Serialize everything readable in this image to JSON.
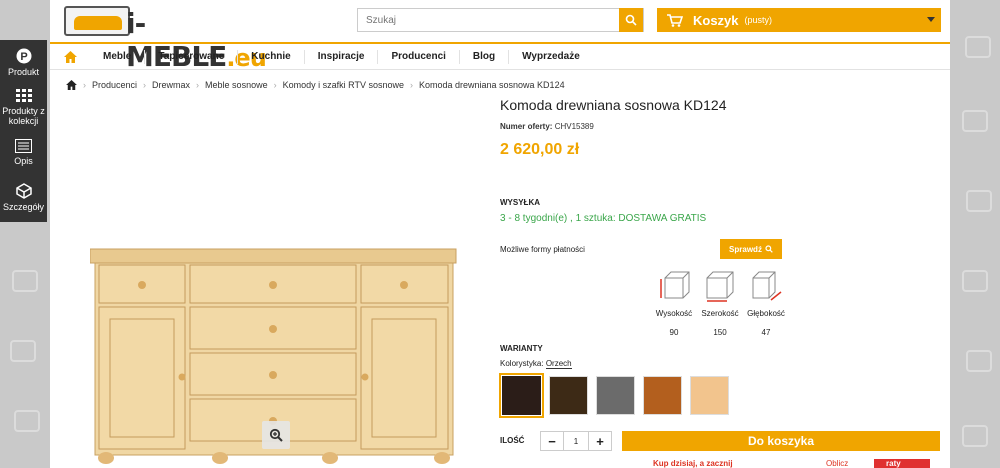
{
  "header": {
    "logo_text": "i-MEBLE",
    "logo_suffix": ".eu",
    "search_placeholder": "Szukaj",
    "cart_label": "Koszyk",
    "cart_status": "(pusty)"
  },
  "nav": {
    "items": [
      "Meble",
      "Tapicerowane",
      "Kuchnie",
      "Inspiracje",
      "Producenci",
      "Blog",
      "Wyprzedaże"
    ]
  },
  "sidepanel": {
    "items": [
      {
        "icon": "p-circle-icon",
        "label": "Produkt"
      },
      {
        "icon": "grid-icon",
        "label": "Produkty z kolekcji"
      },
      {
        "icon": "list-icon",
        "label": "Opis"
      },
      {
        "icon": "cube-icon",
        "label": "Szczegóły"
      }
    ]
  },
  "breadcrumb": [
    "Producenci",
    "Drewmax",
    "Meble sosnowe",
    "Komody i szafki RTV sosnowe",
    "Komoda drewniana sosnowa KD124"
  ],
  "product": {
    "title": "Komoda drewniana sosnowa KD124",
    "offer_label": "Numer oferty:",
    "offer_number": "CHV15389",
    "price": "2 620,00 zł",
    "shipping_label": "WYSYŁKA",
    "shipping_value": "3 - 8 tygodni(e) , 1 sztuka: DOSTAWA GRATIS",
    "payment_label": "Możliwe formy płatności",
    "check_button": "Sprawdź",
    "dimensions": [
      {
        "label": "Wysokość",
        "value": "90"
      },
      {
        "label": "Szerokość",
        "value": "150"
      },
      {
        "label": "Głębokość",
        "value": "47"
      }
    ],
    "variants_label": "WARIANTY",
    "color_label": "Kolorystyka:",
    "color_value": "Orzech",
    "swatches": [
      "#2b1d18",
      "#3d2a16",
      "#6b6b6b",
      "#b35f1e",
      "#f2c48d"
    ],
    "qty_label": "ILOŚĆ",
    "qty_value": "1",
    "add_to_cart": "Do koszyka",
    "promo_text": "Kup dzisiaj, a zacznij",
    "raty_text": "Oblicz",
    "raty_brand": "raty"
  },
  "colors": {
    "accent": "#f0a500",
    "shipping_green": "#3aa64a",
    "sidepanel": "#333333"
  }
}
